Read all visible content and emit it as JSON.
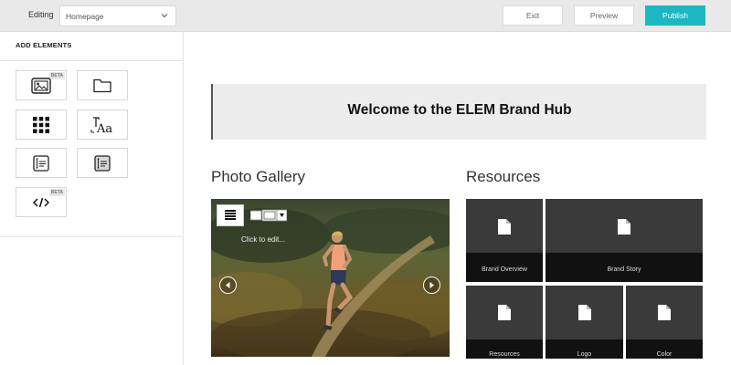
{
  "topbar": {
    "editing_label": "Editing",
    "page_select": {
      "value": "Homepage",
      "icon": "chevron-down-icon"
    },
    "buttons": {
      "exit": "Exit",
      "preview": "Preview",
      "publish": "Publish"
    },
    "accent_color": "#1cb7c0"
  },
  "sidebar": {
    "heading": "ADD ELEMENTS",
    "tiles": [
      {
        "icon": "image-gallery-icon",
        "badge": "BETA"
      },
      {
        "icon": "folder-icon",
        "badge": ""
      },
      {
        "icon": "grid-icon",
        "badge": ""
      },
      {
        "icon": "typography-icon",
        "badge": ""
      },
      {
        "icon": "text-block-icon",
        "badge": ""
      },
      {
        "icon": "text-block-alt-icon",
        "badge": ""
      },
      {
        "icon": "code-icon",
        "badge": "BETA"
      }
    ]
  },
  "main": {
    "welcome_title": "Welcome to the ELEM Brand Hub",
    "gallery": {
      "title": "Photo Gallery",
      "click_to_edit": "Click to edit..."
    },
    "resources": {
      "title": "Resources",
      "items": [
        {
          "label": "Brand Overview",
          "icon": "document-icon"
        },
        {
          "label": "Brand Story",
          "icon": "document-icon"
        },
        {
          "label": "Resources",
          "icon": "document-icon"
        },
        {
          "label": "Logo",
          "icon": "document-icon"
        },
        {
          "label": "Color",
          "icon": "document-icon"
        }
      ]
    }
  }
}
